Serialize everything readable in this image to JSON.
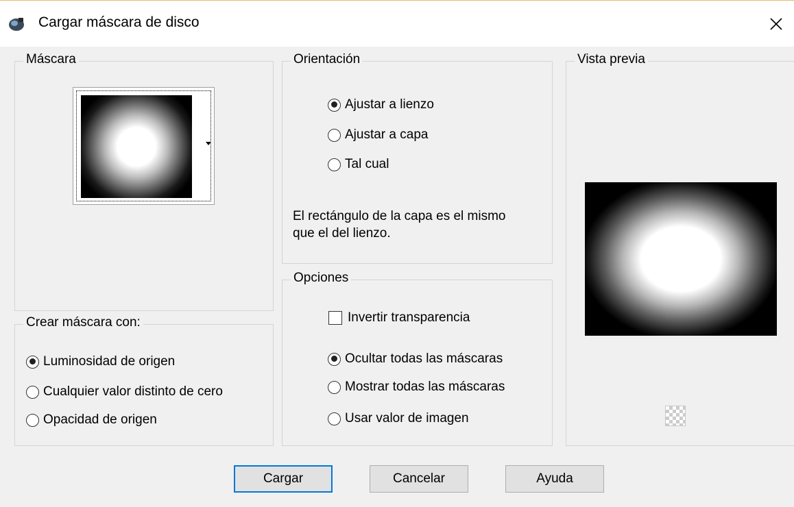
{
  "window": {
    "title": "Cargar máscara de disco",
    "app_icon": "paint-shop-pro-icon",
    "close_icon": "close-icon"
  },
  "mascara": {
    "legend": "Máscara",
    "thumbnail": "disc-mask-thumbnail",
    "dropdown_icon": "dropdown-arrow-icon"
  },
  "crear": {
    "legend": "Crear máscara con:",
    "options": [
      {
        "label": "Luminosidad de origen",
        "selected": true
      },
      {
        "label": "Cualquier valor distinto de cero",
        "selected": false
      },
      {
        "label": "Opacidad de origen",
        "selected": false
      }
    ]
  },
  "orientacion": {
    "legend": "Orientación",
    "options": [
      {
        "label": "Ajustar a lienzo",
        "selected": true
      },
      {
        "label": "Ajustar a capa",
        "selected": false
      },
      {
        "label": "Tal cual",
        "selected": false
      }
    ],
    "help_line1": "El rectángulo de la capa es el mismo",
    "help_line2": "que el del lienzo."
  },
  "opciones": {
    "legend": "Opciones",
    "invert_label": "Invertir transparencia",
    "invert_checked": false,
    "mask_options": [
      {
        "label": "Ocultar todas las máscaras",
        "selected": true
      },
      {
        "label": "Mostrar todas las máscaras",
        "selected": false
      },
      {
        "label": "Usar valor de imagen",
        "selected": false
      }
    ]
  },
  "vista_previa": {
    "legend": "Vista previa",
    "background_icon": "transparency-checker-icon"
  },
  "buttons": {
    "load": "Cargar",
    "cancel": "Cancelar",
    "help": "Ayuda"
  },
  "colors": {
    "dialog_bg": "#f0f0f0",
    "default_button_border": "#0078d7"
  }
}
